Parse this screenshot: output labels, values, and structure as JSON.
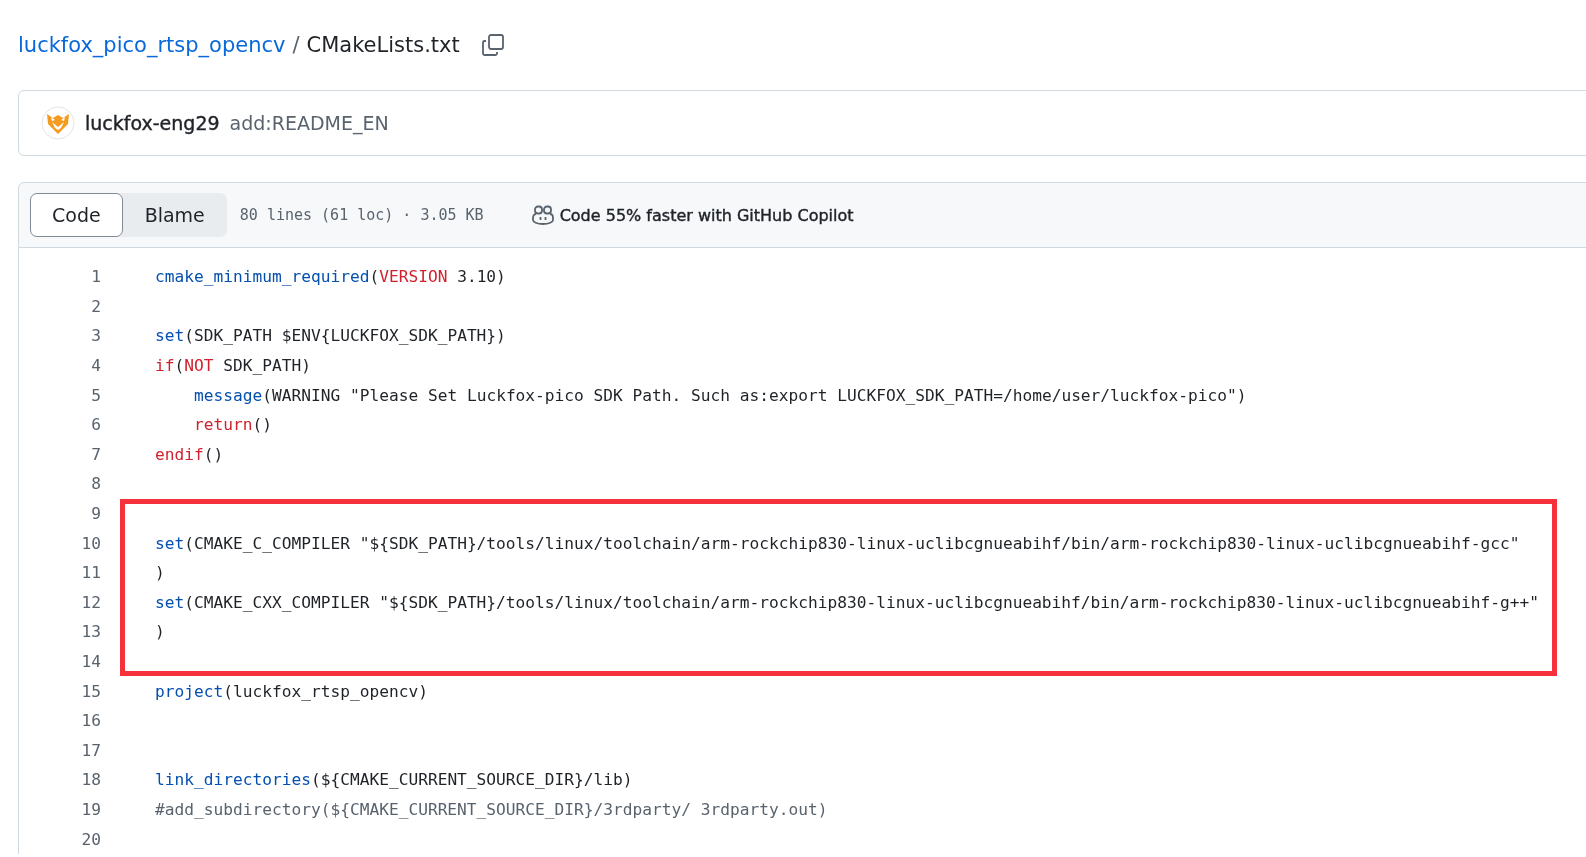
{
  "breadcrumb": {
    "repo": "luckfox_pico_rtsp_opencv",
    "separator": "/",
    "file": "CMakeLists.txt"
  },
  "commit": {
    "author": "luckfox-eng29",
    "message": "add:README_EN"
  },
  "toolbar": {
    "tabs": [
      {
        "label": "Code",
        "selected": true
      },
      {
        "label": "Blame",
        "selected": false
      }
    ],
    "file_info": "80 lines (61 loc) · 3.05 KB",
    "copilot": "Code 55% faster with GitHub Copilot"
  },
  "lines": [
    {
      "number": "1",
      "highlighted": false,
      "tokens": [
        {
          "kind": "fn",
          "text": "cmake_minimum_required"
        },
        {
          "kind": "text",
          "text": "("
        },
        {
          "kind": "kw",
          "text": "VERSION"
        },
        {
          "kind": "text",
          "text": " 3.10)"
        }
      ]
    },
    {
      "number": "2",
      "highlighted": false
    },
    {
      "number": "3",
      "highlighted": false,
      "tokens": [
        {
          "kind": "fn",
          "text": "set"
        },
        {
          "kind": "text",
          "text": "(SDK_PATH $ENV{LUCKFOX_SDK_PATH})"
        }
      ]
    },
    {
      "number": "4",
      "highlighted": false,
      "tokens": [
        {
          "kind": "kw",
          "text": "if"
        },
        {
          "kind": "text",
          "text": "("
        },
        {
          "kind": "kw",
          "text": "NOT"
        },
        {
          "kind": "text",
          "text": " SDK_PATH)"
        }
      ],
      "children": [
        {
          "number": "5",
          "highlighted": false,
          "tokens": [
            {
              "kind": "fn",
              "text": "message"
            },
            {
              "kind": "text",
              "text": "(WARNING \"Please Set Luckfox-pico SDK Path. Such as:export LUCKFOX_SDK_PATH=/home/user/luckfox-pico\")"
            }
          ]
        },
        {
          "number": "6",
          "highlighted": false,
          "tokens": [
            {
              "kind": "kw",
              "text": "return"
            },
            {
              "kind": "text",
              "text": "()"
            }
          ]
        }
      ]
    },
    {
      "number": "7",
      "highlighted": false,
      "tokens": [
        {
          "kind": "kw",
          "text": "endif"
        },
        {
          "kind": "text",
          "text": "()"
        }
      ]
    },
    {
      "number": "8",
      "highlighted": false
    },
    {
      "number": "9",
      "highlighted": true
    },
    {
      "number": "10",
      "highlighted": true,
      "tokens": [
        {
          "kind": "fn",
          "text": "set"
        },
        {
          "kind": "text",
          "text": "(CMAKE_C_COMPILER \"${SDK_PATH}/tools/linux/toolchain/arm-rockchip830-linux-uclibcgnueabihf/bin/arm-rockchip830-linux-uclibcgnueabihf-gcc\""
        }
      ]
    },
    {
      "number": "11",
      "highlighted": true,
      "tokens": [
        {
          "kind": "text",
          "text": ")"
        }
      ]
    },
    {
      "number": "12",
      "highlighted": true,
      "tokens": [
        {
          "kind": "fn",
          "text": "set"
        },
        {
          "kind": "text",
          "text": "(CMAKE_CXX_COMPILER \"${SDK_PATH}/tools/linux/toolchain/arm-rockchip830-linux-uclibcgnueabihf/bin/arm-rockchip830-linux-uclibcgnueabihf-g++\""
        }
      ]
    },
    {
      "number": "13",
      "highlighted": true,
      "tokens": [
        {
          "kind": "text",
          "text": ")"
        }
      ]
    },
    {
      "number": "14",
      "highlighted": true
    },
    {
      "number": "15",
      "highlighted": false,
      "tokens": [
        {
          "kind": "fn",
          "text": "project"
        },
        {
          "kind": "text",
          "text": "(luckfox_rtsp_opencv)"
        }
      ]
    },
    {
      "number": "16",
      "highlighted": false
    },
    {
      "number": "17",
      "highlighted": false
    },
    {
      "number": "18",
      "highlighted": false,
      "tokens": [
        {
          "kind": "fn",
          "text": "link_directories"
        },
        {
          "kind": "text",
          "text": "(${CMAKE_CURRENT_SOURCE_DIR}/lib)"
        }
      ]
    },
    {
      "number": "19",
      "highlighted": false,
      "tokens": [
        {
          "kind": "comment",
          "text": "#add_subdirectory(${CMAKE_CURRENT_SOURCE_DIR}/3rdparty/ 3rdparty.out)"
        }
      ]
    },
    {
      "number": "20",
      "highlighted": false
    }
  ]
}
